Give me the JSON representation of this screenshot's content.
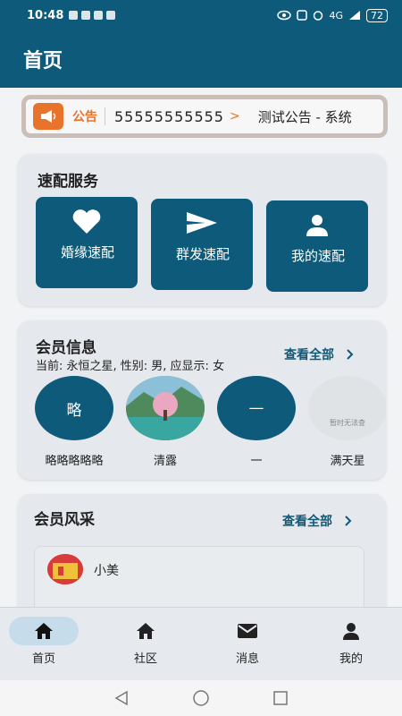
{
  "status": {
    "time": "10:48",
    "network": "4G",
    "battery": "72"
  },
  "appbar": {
    "title": "首页"
  },
  "notice": {
    "tag": "公告",
    "number": "55555555555",
    "chevron": ">",
    "text": "测试公告 - 系统"
  },
  "quick_service": {
    "title": "速配服务",
    "buttons": [
      {
        "label": "婚缘速配",
        "icon": "heart-icon"
      },
      {
        "label": "群发速配",
        "icon": "send-icon"
      },
      {
        "label": "我的速配",
        "icon": "person-icon"
      }
    ]
  },
  "member_info": {
    "title": "会员信息",
    "subtitle": "当前: 永恒之星, 性别: 男, 应显示: 女",
    "view_all": "查看全部",
    "members": [
      {
        "avatar_text": "略",
        "name": "略略略略略"
      },
      {
        "avatar_text": "",
        "name": "清露"
      },
      {
        "avatar_text": "—",
        "name": "一"
      },
      {
        "avatar_text": "暂时无法查",
        "name": "满天星"
      }
    ]
  },
  "member_showcase": {
    "title": "会员风采",
    "view_all": "查看全部",
    "first_user": "小美"
  },
  "bottom_nav": [
    {
      "label": "首页",
      "icon": "home-icon",
      "active": true
    },
    {
      "label": "社区",
      "icon": "community-icon",
      "active": false
    },
    {
      "label": "消息",
      "icon": "mail-icon",
      "active": false
    },
    {
      "label": "我的",
      "icon": "profile-icon",
      "active": false
    }
  ],
  "colors": {
    "primary": "#0e5a7a",
    "accent": "#e8742c",
    "background": "#f2f3f5",
    "card": "#e5e8ec"
  }
}
